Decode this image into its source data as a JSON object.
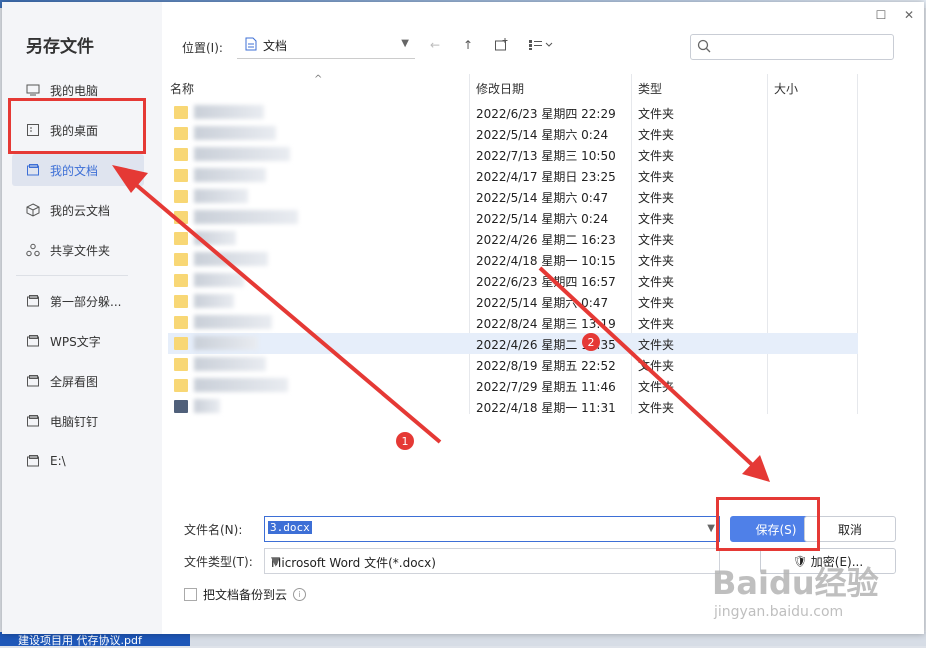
{
  "dialog": {
    "title": "另存文件"
  },
  "sidebar": {
    "items": [
      {
        "label": "我的电脑",
        "icon": "monitor-icon"
      },
      {
        "label": "我的桌面",
        "icon": "desktop-icon"
      },
      {
        "label": "我的文档",
        "icon": "folder-icon"
      },
      {
        "label": "我的云文档",
        "icon": "cloud-cube-icon"
      },
      {
        "label": "共享文件夹",
        "icon": "share-icon"
      },
      {
        "label": "第一部分躲...",
        "icon": "folder-icon"
      },
      {
        "label": "WPS文字",
        "icon": "folder-icon"
      },
      {
        "label": "全屏看图",
        "icon": "folder-icon"
      },
      {
        "label": "电脑钉钉",
        "icon": "folder-icon"
      },
      {
        "label": "E:\\",
        "icon": "folder-icon"
      }
    ]
  },
  "toolbar": {
    "location_label": "位置(I):",
    "location_value": "文档"
  },
  "columns": {
    "name": "名称",
    "modified": "修改日期",
    "type": "类型",
    "size": "大小"
  },
  "files": [
    {
      "date": "2022/6/23 星期四 22:29",
      "type": "文件夹"
    },
    {
      "date": "2022/5/14 星期六 0:24",
      "type": "文件夹"
    },
    {
      "date": "2022/7/13 星期三 10:50",
      "type": "文件夹"
    },
    {
      "date": "2022/4/17 星期日 23:25",
      "type": "文件夹"
    },
    {
      "date": "2022/5/14 星期六 0:47",
      "type": "文件夹"
    },
    {
      "date": "2022/5/14 星期六 0:24",
      "type": "文件夹"
    },
    {
      "date": "2022/4/26 星期二 16:23",
      "type": "文件夹"
    },
    {
      "date": "2022/4/18 星期一 10:15",
      "type": "文件夹"
    },
    {
      "date": "2022/6/23 星期四 16:57",
      "type": "文件夹"
    },
    {
      "date": "2022/5/14 星期六 0:47",
      "type": "文件夹"
    },
    {
      "date": "2022/8/24 星期三 13:19",
      "type": "文件夹"
    },
    {
      "date": "2022/4/26 星期二 16:35",
      "type": "文件夹"
    },
    {
      "date": "2022/8/19 星期五 22:52",
      "type": "文件夹"
    },
    {
      "date": "2022/7/29 星期五 11:46",
      "type": "文件夹"
    },
    {
      "date": "2022/4/18 星期一 11:31",
      "type": "文件夹"
    }
  ],
  "form": {
    "filename_label": "文件名(N):",
    "filename_value": "3.docx",
    "filetype_label": "文件类型(T):",
    "filetype_value": "Microsoft Word 文件(*.docx)",
    "backup_label": "把文档备份到云",
    "save_label": "保存(S)",
    "cancel_label": "取消",
    "encrypt_label": "加密(E)..."
  },
  "annotations": {
    "badge1": "1",
    "badge2": "2"
  },
  "taskbar": {
    "text": "建设项目用 代存协议.pdf"
  },
  "watermark": {
    "logo": "Baidu经验",
    "url": "jingyan.baidu.com"
  }
}
